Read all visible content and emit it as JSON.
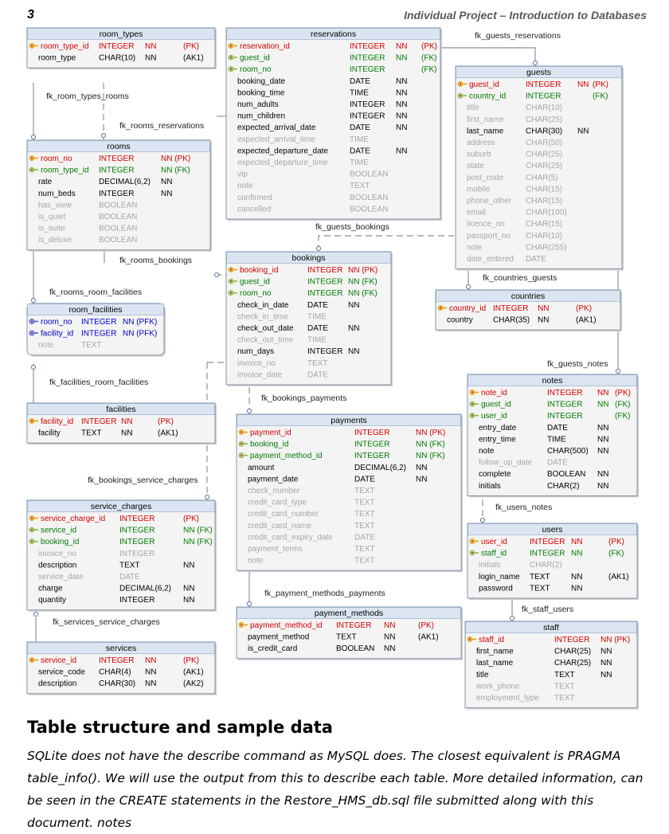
{
  "page": {
    "number": "3",
    "title": "Individual Project – Introduction to Databases",
    "heading": "Table structure and sample data",
    "paragraph": "SQLite does not have the describe command as MySQL does. The closest equivalent is PRAGMA table_info(). We will use the output from this to describe each table. More detailed information, can be seen in the CREATE statements in the Restore_HMS_db.sql file submitted along with this document. notes"
  },
  "colors": {
    "header_bg": "#dbe5f1",
    "header_border": "#8aa6c9",
    "pk": "#d40000",
    "fk": "#007a00",
    "pfk": "#0000cc",
    "nullable": "#a6a6a6",
    "key_pk_icon": "#e8a300",
    "key_fk_icon": "#7fbf3f",
    "key_pfk_icon": "#4060e0"
  },
  "relationships": [
    "fk_room_types_rooms",
    "fk_rooms_reservations",
    "fk_guests_reservations",
    "fk_guests_bookings",
    "fk_rooms_bookings",
    "fk_rooms_room_facilities",
    "fk_facilities_room_facilities",
    "fk_countries_guests",
    "fk_guests_notes",
    "fk_bookings_payments",
    "fk_bookings_service_charges",
    "fk_users_notes",
    "fk_payment_methods_payments",
    "fk_services_service_charges",
    "fk_staff_users"
  ],
  "tables": [
    {
      "name": "room_types",
      "columns": [
        {
          "k": "pk",
          "name": "room_type_id",
          "type": "INTEGER",
          "nn": "NN",
          "key": "(PK)"
        },
        {
          "k": "n",
          "name": "room_type",
          "type": "CHAR(10)",
          "nn": "NN",
          "key": "(AK1)"
        }
      ]
    },
    {
      "name": "reservations",
      "columns": [
        {
          "k": "pk",
          "name": "reservation_id",
          "type": "INTEGER",
          "nn": "NN",
          "key": "(PK)"
        },
        {
          "k": "fk",
          "name": "guest_id",
          "type": "INTEGER",
          "nn": "NN",
          "key": "(FK)"
        },
        {
          "k": "fk",
          "name": "room_no",
          "type": "INTEGER",
          "nn": "",
          "key": "(FK)"
        },
        {
          "k": "n",
          "name": "booking_date",
          "type": "DATE",
          "nn": "NN",
          "key": ""
        },
        {
          "k": "n",
          "name": "booking_time",
          "type": "TIME",
          "nn": "NN",
          "key": ""
        },
        {
          "k": "n",
          "name": "num_adults",
          "type": "INTEGER",
          "nn": "NN",
          "key": ""
        },
        {
          "k": "n",
          "name": "num_children",
          "type": "INTEGER",
          "nn": "NN",
          "key": ""
        },
        {
          "k": "n",
          "name": "expected_arrival_date",
          "type": "DATE",
          "nn": "NN",
          "key": ""
        },
        {
          "k": "g",
          "name": "expected_arrival_time",
          "type": "TIME",
          "nn": "",
          "key": ""
        },
        {
          "k": "n",
          "name": "expected_departure_date",
          "type": "DATE",
          "nn": "NN",
          "key": ""
        },
        {
          "k": "g",
          "name": "expected_departure_time",
          "type": "TIME",
          "nn": "",
          "key": ""
        },
        {
          "k": "g",
          "name": "vip",
          "type": "BOOLEAN",
          "nn": "",
          "key": ""
        },
        {
          "k": "g",
          "name": "note",
          "type": "TEXT",
          "nn": "",
          "key": ""
        },
        {
          "k": "g",
          "name": "confirmed",
          "type": "BOOLEAN",
          "nn": "",
          "key": ""
        },
        {
          "k": "g",
          "name": "cancelled",
          "type": "BOOLEAN",
          "nn": "",
          "key": ""
        }
      ]
    },
    {
      "name": "guests",
      "columns": [
        {
          "k": "pk",
          "name": "guest_id",
          "type": "INTEGER",
          "nn": "NN",
          "key": "(PK)"
        },
        {
          "k": "fk",
          "name": "country_id",
          "type": "INTEGER",
          "nn": "",
          "key": "(FK)"
        },
        {
          "k": "g",
          "name": "title",
          "type": "CHAR(10)",
          "nn": "",
          "key": ""
        },
        {
          "k": "g",
          "name": "first_name",
          "type": "CHAR(25)",
          "nn": "",
          "key": ""
        },
        {
          "k": "n",
          "name": "last_name",
          "type": "CHAR(30)",
          "nn": "NN",
          "key": ""
        },
        {
          "k": "g",
          "name": "address",
          "type": "CHAR(50)",
          "nn": "",
          "key": ""
        },
        {
          "k": "g",
          "name": "suburb",
          "type": "CHAR(25)",
          "nn": "",
          "key": ""
        },
        {
          "k": "g",
          "name": "state",
          "type": "CHAR(25)",
          "nn": "",
          "key": ""
        },
        {
          "k": "g",
          "name": "post_code",
          "type": "CHAR(5)",
          "nn": "",
          "key": ""
        },
        {
          "k": "g",
          "name": "mobile",
          "type": "CHAR(15)",
          "nn": "",
          "key": ""
        },
        {
          "k": "g",
          "name": "phone_other",
          "type": "CHAR(15)",
          "nn": "",
          "key": ""
        },
        {
          "k": "g",
          "name": "email",
          "type": "CHAR(100)",
          "nn": "",
          "key": ""
        },
        {
          "k": "g",
          "name": "licence_no",
          "type": "CHAR(15)",
          "nn": "",
          "key": ""
        },
        {
          "k": "g",
          "name": "passport_no",
          "type": "CHAR(10)",
          "nn": "",
          "key": ""
        },
        {
          "k": "g",
          "name": "note",
          "type": "CHAR(255)",
          "nn": "",
          "key": ""
        },
        {
          "k": "g",
          "name": "date_entered",
          "type": "DATE",
          "nn": "",
          "key": ""
        }
      ]
    },
    {
      "name": "rooms",
      "columns": [
        {
          "k": "pk",
          "name": "room_no",
          "type": "INTEGER",
          "nn": "NN",
          "key": "(PK)"
        },
        {
          "k": "fk",
          "name": "room_type_id",
          "type": "INTEGER",
          "nn": "NN",
          "key": "(FK)"
        },
        {
          "k": "n",
          "name": "rate",
          "type": "DECIMAL(6,2)",
          "nn": "NN",
          "key": ""
        },
        {
          "k": "n",
          "name": "num_beds",
          "type": "INTEGER",
          "nn": "NN",
          "key": ""
        },
        {
          "k": "g",
          "name": "has_view",
          "type": "BOOLEAN",
          "nn": "",
          "key": ""
        },
        {
          "k": "g",
          "name": "is_quiet",
          "type": "BOOLEAN",
          "nn": "",
          "key": ""
        },
        {
          "k": "g",
          "name": "is_suite",
          "type": "BOOLEAN",
          "nn": "",
          "key": ""
        },
        {
          "k": "g",
          "name": "is_deluxe",
          "type": "BOOLEAN",
          "nn": "",
          "key": ""
        }
      ]
    },
    {
      "name": "bookings",
      "columns": [
        {
          "k": "pk",
          "name": "booking_id",
          "type": "INTEGER",
          "nn": "NN",
          "key": "(PK)"
        },
        {
          "k": "fk",
          "name": "guest_id",
          "type": "INTEGER",
          "nn": "NN",
          "key": "(FK)"
        },
        {
          "k": "fk",
          "name": "room_no",
          "type": "INTEGER",
          "nn": "NN",
          "key": "(FK)"
        },
        {
          "k": "n",
          "name": "check_in_date",
          "type": "DATE",
          "nn": "NN",
          "key": ""
        },
        {
          "k": "g",
          "name": "check_in_time",
          "type": "TIME",
          "nn": "",
          "key": ""
        },
        {
          "k": "n",
          "name": "check_out_date",
          "type": "DATE",
          "nn": "NN",
          "key": ""
        },
        {
          "k": "g",
          "name": "check_out_time",
          "type": "TIME",
          "nn": "",
          "key": ""
        },
        {
          "k": "n",
          "name": "num_days",
          "type": "INTEGER",
          "nn": "NN",
          "key": ""
        },
        {
          "k": "g",
          "name": "invoice_no",
          "type": "TEXT",
          "nn": "",
          "key": ""
        },
        {
          "k": "g",
          "name": "invoice_date",
          "type": "DATE",
          "nn": "",
          "key": ""
        }
      ]
    },
    {
      "name": "room_facilities",
      "columns": [
        {
          "k": "pfk",
          "name": "room_no",
          "type": "INTEGER",
          "nn": "NN",
          "key": "(PFK)"
        },
        {
          "k": "pfk",
          "name": "facility_id",
          "type": "INTEGER",
          "nn": "NN",
          "key": "(PFK)"
        },
        {
          "k": "g",
          "name": "note",
          "type": "TEXT",
          "nn": "",
          "key": ""
        }
      ]
    },
    {
      "name": "countries",
      "columns": [
        {
          "k": "pk",
          "name": "country_id",
          "type": "INTEGER",
          "nn": "NN",
          "key": "(PK)"
        },
        {
          "k": "n",
          "name": "country",
          "type": "CHAR(35)",
          "nn": "NN",
          "key": "(AK1)"
        }
      ]
    },
    {
      "name": "notes",
      "columns": [
        {
          "k": "pk",
          "name": "note_id",
          "type": "INTEGER",
          "nn": "NN",
          "key": "(PK)"
        },
        {
          "k": "fk",
          "name": "guest_id",
          "type": "INTEGER",
          "nn": "NN",
          "key": "(FK)"
        },
        {
          "k": "fk",
          "name": "user_id",
          "type": "INTEGER",
          "nn": "",
          "key": "(FK)"
        },
        {
          "k": "n",
          "name": "entry_date",
          "type": "DATE",
          "nn": "NN",
          "key": ""
        },
        {
          "k": "n",
          "name": "entry_time",
          "type": "TIME",
          "nn": "NN",
          "key": ""
        },
        {
          "k": "n",
          "name": "note",
          "type": "CHAR(500)",
          "nn": "NN",
          "key": ""
        },
        {
          "k": "g",
          "name": "follow_up_date",
          "type": "DATE",
          "nn": "",
          "key": ""
        },
        {
          "k": "n",
          "name": "complete",
          "type": "BOOLEAN",
          "nn": "NN",
          "key": ""
        },
        {
          "k": "n",
          "name": "initials",
          "type": "CHAR(2)",
          "nn": "NN",
          "key": ""
        }
      ]
    },
    {
      "name": "facilities",
      "columns": [
        {
          "k": "pk",
          "name": "facility_id",
          "type": "INTEGER",
          "nn": "NN",
          "key": "(PK)"
        },
        {
          "k": "n",
          "name": "facility",
          "type": "TEXT",
          "nn": "NN",
          "key": "(AK1)"
        }
      ]
    },
    {
      "name": "payments",
      "columns": [
        {
          "k": "pk",
          "name": "payment_id",
          "type": "INTEGER",
          "nn": "NN",
          "key": "(PK)"
        },
        {
          "k": "fk",
          "name": "booking_id",
          "type": "INTEGER",
          "nn": "NN",
          "key": "(FK)"
        },
        {
          "k": "fk",
          "name": "payment_method_id",
          "type": "INTEGER",
          "nn": "NN",
          "key": "(FK)"
        },
        {
          "k": "n",
          "name": "amount",
          "type": "DECIMAL(6,2)",
          "nn": "NN",
          "key": ""
        },
        {
          "k": "n",
          "name": "payment_date",
          "type": "DATE",
          "nn": "NN",
          "key": ""
        },
        {
          "k": "g",
          "name": "check_number",
          "type": "TEXT",
          "nn": "",
          "key": ""
        },
        {
          "k": "g",
          "name": "credit_card_type",
          "type": "TEXT",
          "nn": "",
          "key": ""
        },
        {
          "k": "g",
          "name": "credit_card_number",
          "type": "TEXT",
          "nn": "",
          "key": ""
        },
        {
          "k": "g",
          "name": "credit_card_name",
          "type": "TEXT",
          "nn": "",
          "key": ""
        },
        {
          "k": "g",
          "name": "credit_card_expiry_date",
          "type": "DATE",
          "nn": "",
          "key": ""
        },
        {
          "k": "g",
          "name": "payment_terms",
          "type": "TEXT",
          "nn": "",
          "key": ""
        },
        {
          "k": "g",
          "name": "note",
          "type": "TEXT",
          "nn": "",
          "key": ""
        }
      ]
    },
    {
      "name": "service_charges",
      "columns": [
        {
          "k": "pk",
          "name": "service_charge_id",
          "type": "INTEGER",
          "nn": "",
          "key": "(PK)"
        },
        {
          "k": "fk",
          "name": "service_id",
          "type": "INTEGER",
          "nn": "NN",
          "key": "(FK)"
        },
        {
          "k": "fk",
          "name": "booking_id",
          "type": "INTEGER",
          "nn": "NN",
          "key": "(FK)"
        },
        {
          "k": "g",
          "name": "invoice_no",
          "type": "INTEGER",
          "nn": "",
          "key": ""
        },
        {
          "k": "n",
          "name": "description",
          "type": "TEXT",
          "nn": "NN",
          "key": ""
        },
        {
          "k": "g",
          "name": "service_date",
          "type": "DATE",
          "nn": "",
          "key": ""
        },
        {
          "k": "n",
          "name": "charge",
          "type": "DECIMAL(6,2)",
          "nn": "NN",
          "key": ""
        },
        {
          "k": "n",
          "name": "quantity",
          "type": "INTEGER",
          "nn": "NN",
          "key": ""
        }
      ]
    },
    {
      "name": "users",
      "columns": [
        {
          "k": "pk",
          "name": "user_id",
          "type": "INTEGER",
          "nn": "NN",
          "key": "(PK)"
        },
        {
          "k": "fk",
          "name": "staff_id",
          "type": "INTEGER",
          "nn": "NN",
          "key": "(FK)"
        },
        {
          "k": "g",
          "name": "initials",
          "type": "CHAR(2)",
          "nn": "",
          "key": ""
        },
        {
          "k": "n",
          "name": "login_name",
          "type": "TEXT",
          "nn": "NN",
          "key": "(AK1)"
        },
        {
          "k": "n",
          "name": "password",
          "type": "TEXT",
          "nn": "NN",
          "key": ""
        }
      ]
    },
    {
      "name": "payment_methods",
      "columns": [
        {
          "k": "pk",
          "name": "payment_method_id",
          "type": "INTEGER",
          "nn": "NN",
          "key": "(PK)"
        },
        {
          "k": "n",
          "name": "payment_method",
          "type": "TEXT",
          "nn": "NN",
          "key": "(AK1)"
        },
        {
          "k": "n",
          "name": "is_credit_card",
          "type": "BOOLEAN",
          "nn": "NN",
          "key": ""
        }
      ]
    },
    {
      "name": "services",
      "columns": [
        {
          "k": "pk",
          "name": "service_id",
          "type": "INTEGER",
          "nn": "NN",
          "key": "(PK)"
        },
        {
          "k": "n",
          "name": "service_code",
          "type": "CHAR(4)",
          "nn": "NN",
          "key": "(AK1)"
        },
        {
          "k": "n",
          "name": "description",
          "type": "CHAR(30)",
          "nn": "NN",
          "key": "(AK2)"
        }
      ]
    },
    {
      "name": "staff",
      "columns": [
        {
          "k": "pk",
          "name": "staff_id",
          "type": "INTEGER",
          "nn": "NN",
          "key": "(PK)"
        },
        {
          "k": "n",
          "name": "first_name",
          "type": "CHAR(25)",
          "nn": "NN",
          "key": ""
        },
        {
          "k": "n",
          "name": "last_name",
          "type": "CHAR(25)",
          "nn": "NN",
          "key": ""
        },
        {
          "k": "n",
          "name": "title",
          "type": "TEXT",
          "nn": "NN",
          "key": ""
        },
        {
          "k": "g",
          "name": "work_phone",
          "type": "TEXT",
          "nn": "",
          "key": ""
        },
        {
          "k": "g",
          "name": "employment_type",
          "type": "TEXT",
          "nn": "",
          "key": ""
        }
      ]
    }
  ]
}
